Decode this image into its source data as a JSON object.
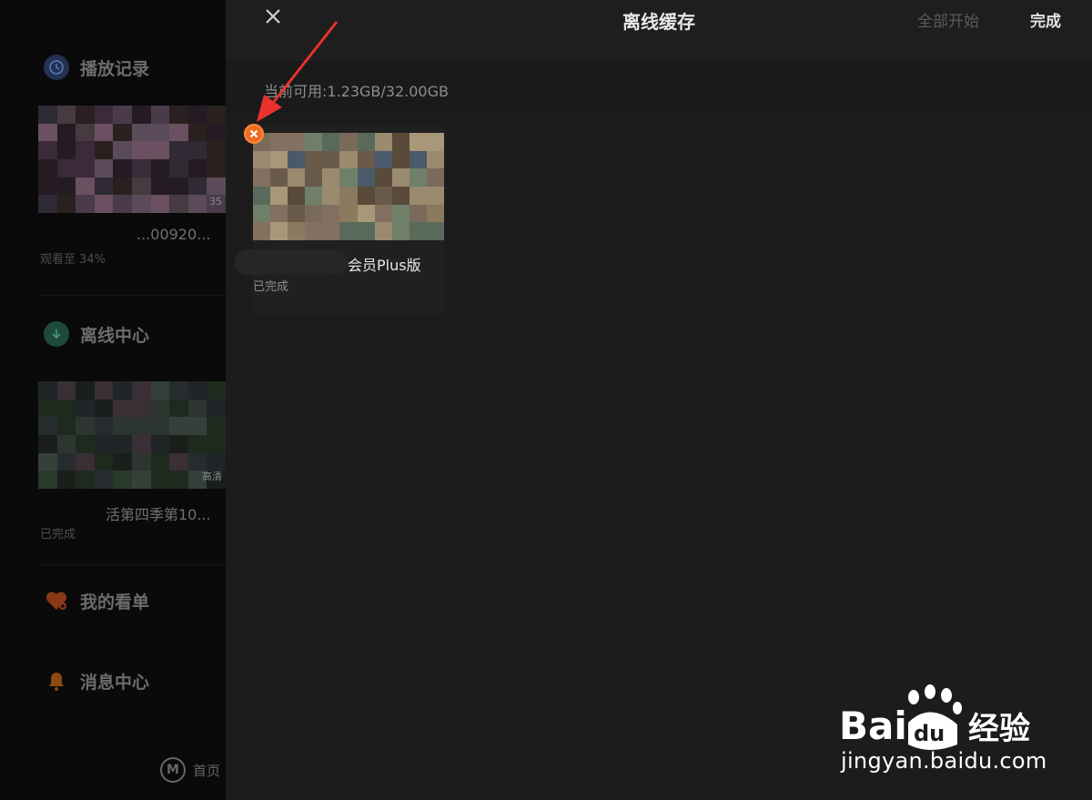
{
  "sidebar": {
    "history": {
      "label": "播放记录",
      "item_title": "...00920...",
      "item_progress": "观看至 34%",
      "item_badge": "35"
    },
    "offline": {
      "label": "离线中心",
      "item_title": "活第四季第10...",
      "item_status": "已完成",
      "item_badge": "高清"
    },
    "watchlist": {
      "label": "我的看单"
    },
    "messages": {
      "label": "消息中心"
    },
    "home": {
      "label": "首页"
    }
  },
  "topbar": {
    "close_icon": "close-icon",
    "title": "离线缓存",
    "start_all": "全部开始",
    "done": "完成"
  },
  "storage": {
    "text": "当前可用:1.23GB/32.00GB"
  },
  "downloads": [
    {
      "title": "会员Plus版",
      "status": "已完成"
    }
  ],
  "watermark": {
    "brand": "Bai",
    "brand2": "du",
    "suffix": "经验",
    "url": "jingyan.baidu.com"
  },
  "colors": {
    "accent_orange": "#f06a21",
    "main_bg": "#1c1c1c",
    "sidebar_bg": "#0a0a0a",
    "annotation_red": "#e8322b"
  }
}
